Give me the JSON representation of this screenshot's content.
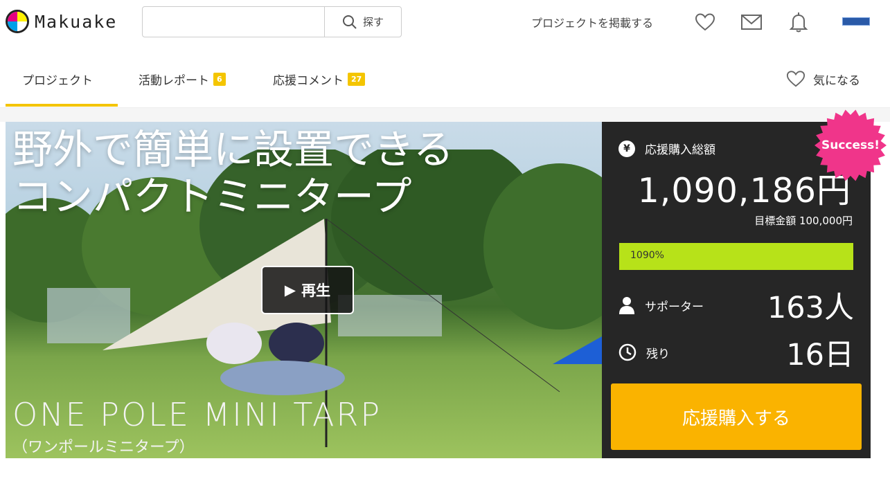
{
  "header": {
    "logo_text": "Makuake",
    "search_placeholder": "",
    "search_button_label": "探す",
    "post_project_link": "プロジェクトを掲載する"
  },
  "tabs": {
    "items": [
      {
        "label": "プロジェクト",
        "badge": null
      },
      {
        "label": "活動レポート",
        "badge": "6"
      },
      {
        "label": "応援コメント",
        "badge": "27"
      }
    ],
    "active_index": 0,
    "watch_label": "気になる"
  },
  "hero": {
    "title_line1": "野外で簡単に設置できる",
    "title_line2": "コンパクトミニタープ",
    "subtitle": "ONE POLE MINI TARP",
    "subtitle_ja": "（ワンポールミニタープ）",
    "play_label": "再生"
  },
  "panel": {
    "total_label": "応援購入総額",
    "total_amount": "1,090,186円",
    "goal_text": "目標金額 100,000円",
    "progress_percent": 1090,
    "progress_text": "1090%",
    "supporters_label": "サポーター",
    "supporters_value": "163人",
    "remaining_label": "残り",
    "remaining_value": "16日",
    "buy_button_label": "応援購入する",
    "success_badge": "Success!"
  },
  "colors": {
    "accent_yellow": "#f4c500",
    "buy_button": "#fab300",
    "progress_fill": "#b7e219",
    "panel_bg": "#262626",
    "success_pink": "#f0358a"
  }
}
